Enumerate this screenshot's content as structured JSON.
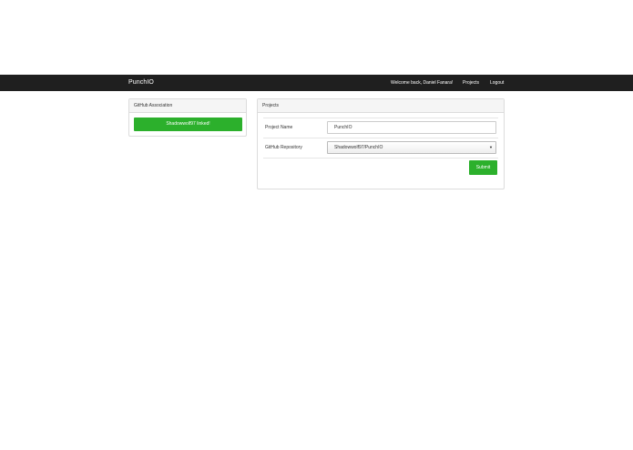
{
  "navbar": {
    "brand": "PunchIO",
    "welcome": "Welcome back, Daniel Fanara!",
    "projects_link": "Projects",
    "logout_link": "Logout"
  },
  "github_panel": {
    "heading": "GitHub Association",
    "linked_label": "Shadowwolf97 linked!"
  },
  "projects_panel": {
    "heading": "Projects",
    "project_name_label": "Project Name",
    "project_name_value": "PunchIO",
    "repo_label": "GitHub Repository",
    "repo_value": "Shadowwolf97/PunchIO",
    "submit_label": "Submit"
  },
  "colors": {
    "navbar_bg": "#1f1f1f",
    "accent_green": "#2cb02c"
  }
}
